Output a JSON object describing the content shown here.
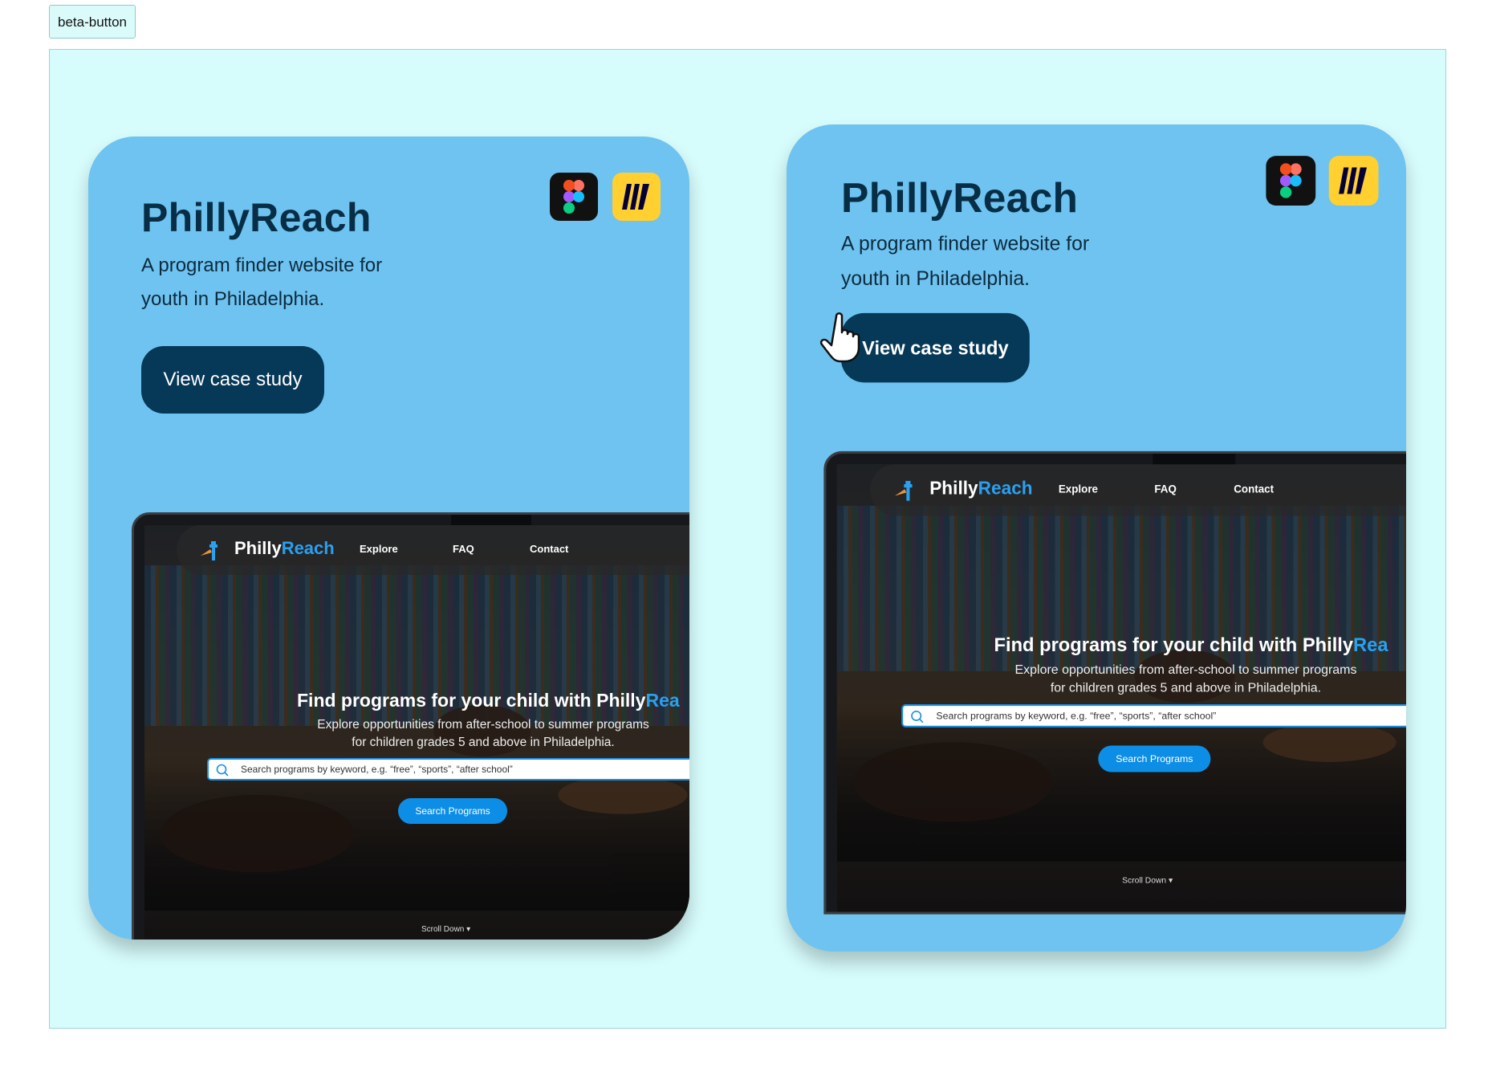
{
  "label": "beta-button",
  "cards": [
    {
      "title": "PhillyReach",
      "description": "A program finder website for youth in Philadelphia.",
      "cta": "View case study",
      "icons": [
        "figma-icon",
        "miro-icon"
      ],
      "preview": {
        "logo_a": "Philly",
        "logo_b": "Reach",
        "nav": [
          "Explore",
          "FAQ",
          "Contact"
        ],
        "hero_title_a": "Find programs for your child with Philly",
        "hero_title_b": "Rea",
        "hero_sub": "Explore opportunities from after-school to summer programs for children grades 5 and above in Philadelphia.",
        "search_placeholder": "Search programs by keyword, e.g. “free”, “sports”, “after school”",
        "search_button": "Search Programs",
        "scroll": "Scroll Down"
      }
    },
    {
      "title": "PhillyReach",
      "description": "A program finder website for youth in Philadelphia.",
      "cta": "View case study",
      "icons": [
        "figma-icon",
        "miro-icon"
      ],
      "state": "hover",
      "preview": {
        "logo_a": "Philly",
        "logo_b": "Reach",
        "nav": [
          "Explore",
          "FAQ",
          "Contact"
        ],
        "hero_title_a": "Find programs for your child with Philly",
        "hero_title_b": "Rea",
        "hero_sub": "Explore opportunities from after-school to summer programs for children grades 5 and above in Philadelphia.",
        "search_placeholder": "Search programs by keyword, e.g. “free”, “sports”, “after school”",
        "search_button": "Search Programs",
        "scroll": "Scroll Down"
      }
    }
  ],
  "colors": {
    "frame": "#d7fcfc",
    "card": "#6fc3f0",
    "button": "#063857",
    "brand_blue": "#2aa0f0"
  }
}
